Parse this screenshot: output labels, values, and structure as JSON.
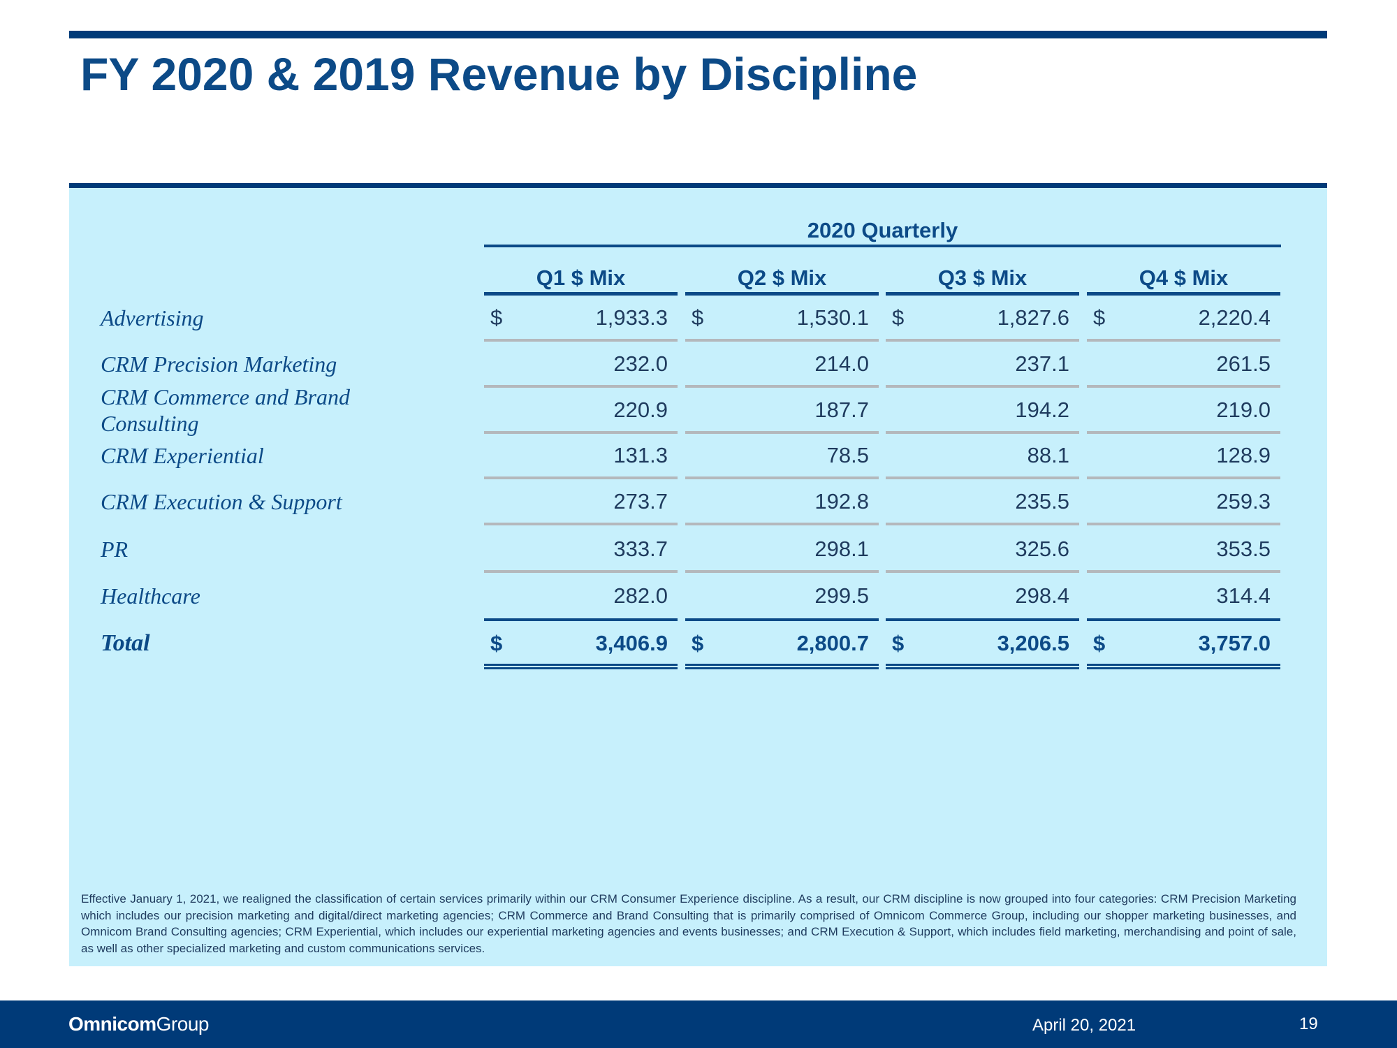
{
  "title": "FY 2020 & 2019 Revenue by Discipline",
  "table": {
    "group_header": "2020 Quarterly",
    "columns": [
      "Q1 $ Mix",
      "Q2 $ Mix",
      "Q3 $ Mix",
      "Q4 $ Mix"
    ],
    "currency_symbol": "$",
    "rows": [
      {
        "label": "Advertising",
        "values": [
          "1,933.3",
          "1,530.1",
          "1,827.6",
          "2,220.4"
        ],
        "show_currency": true
      },
      {
        "label": "CRM Precision Marketing",
        "values": [
          "232.0",
          "214.0",
          "237.1",
          "261.5"
        ],
        "show_currency": false
      },
      {
        "label": "CRM Commerce and Brand Consulting",
        "values": [
          "220.9",
          "187.7",
          "194.2",
          "219.0"
        ],
        "show_currency": false
      },
      {
        "label": "CRM Experiential",
        "values": [
          "131.3",
          "78.5",
          "88.1",
          "128.9"
        ],
        "show_currency": false
      },
      {
        "label": "CRM Execution & Support",
        "values": [
          "273.7",
          "192.8",
          "235.5",
          "259.3"
        ],
        "show_currency": false
      },
      {
        "label": "PR",
        "values": [
          "333.7",
          "298.1",
          "325.6",
          "353.5"
        ],
        "show_currency": false
      },
      {
        "label": "Healthcare",
        "values": [
          "282.0",
          "299.5",
          "298.4",
          "314.4"
        ],
        "show_currency": false
      }
    ],
    "total": {
      "label": "Total",
      "values": [
        "3,406.9",
        "2,800.7",
        "3,206.5",
        "3,757.0"
      ]
    }
  },
  "footnote": "Effective January 1, 2021, we realigned the classification of certain services primarily within our CRM Consumer Experience discipline. As a result, our CRM discipline is now grouped into four categories: CRM Precision Marketing which includes our precision marketing and digital/direct marketing agencies; CRM Commerce and Brand Consulting that is primarily comprised of Omnicom Commerce Group, including our shopper marketing businesses, and Omnicom Brand Consulting agencies; CRM Experiential, which includes our experiential marketing agencies and events businesses; and CRM Execution & Support, which includes field marketing, merchandising and point of sale, as well as other specialized marketing and custom communications services.",
  "footer": {
    "logo_bold": "Omnicom",
    "logo_light": "Group",
    "date": "April 20, 2021",
    "page_number": "19"
  },
  "colors": {
    "brand_navy": "#003a78",
    "title_blue": "#0c4a87",
    "panel_bg": "#c7f0fc"
  }
}
